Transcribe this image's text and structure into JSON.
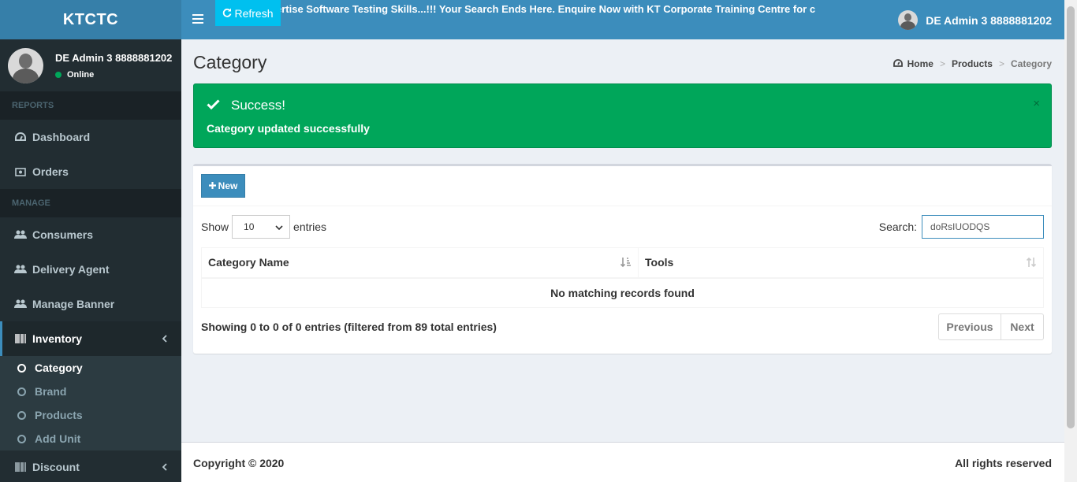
{
  "app": {
    "logo": "KTCTC"
  },
  "user": {
    "name": "DE Admin 3 8888881202",
    "status": "Online"
  },
  "header": {
    "refresh_label": "Refresh",
    "marquee": "ertise Software Testing Skills...!!! Your Search Ends Here. Enquire Now with KT Corporate Training Centre for c",
    "user_name": "DE Admin 3 8888881202"
  },
  "sidebar": {
    "sections": {
      "reports": "REPORTS",
      "manage": "MANAGE"
    },
    "items": {
      "dashboard": "Dashboard",
      "orders": "Orders",
      "consumers": "Consumers",
      "delivery_agent": "Delivery Agent",
      "manage_banner": "Manage Banner",
      "inventory": "Inventory",
      "discount": "Discount"
    },
    "inventory_sub": {
      "category": "Category",
      "brand": "Brand",
      "products": "Products",
      "add_unit": "Add Unit"
    }
  },
  "page": {
    "title": "Category",
    "breadcrumb": [
      "Home",
      "Products",
      "Category"
    ]
  },
  "alert": {
    "title": "Success!",
    "message": "Category updated successfully",
    "close": "×"
  },
  "table": {
    "new_button": "New",
    "show_label": "Show",
    "entries_label": "entries",
    "page_length": "10",
    "search_label": "Search:",
    "search_value": "doRsIUODQS",
    "columns": [
      "Category Name",
      "Tools"
    ],
    "empty_message": "No matching records found",
    "info": "Showing 0 to 0 of 0 entries (filtered from 89 total entries)",
    "prev_label": "Previous",
    "next_label": "Next"
  },
  "footer": {
    "copyright": "Copyright © 2020",
    "rights": "All rights reserved"
  },
  "colors": {
    "brand": "#3c8dbc",
    "sidebar": "#222d32",
    "success": "#00a65a",
    "info": "#00c0ef"
  }
}
